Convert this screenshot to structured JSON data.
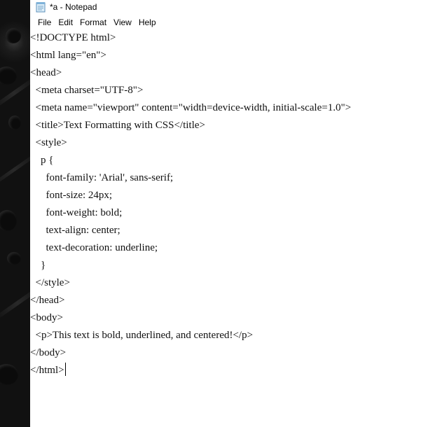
{
  "window": {
    "title": "*a - Notepad"
  },
  "menu": {
    "items": [
      "File",
      "Edit",
      "Format",
      "View",
      "Help"
    ]
  },
  "editor": {
    "lines": [
      "<!DOCTYPE html>",
      "<html lang=\"en\">",
      "<head>",
      "  <meta charset=\"UTF-8\">",
      "  <meta name=\"viewport\" content=\"width=device-width, initial-scale=1.0\">",
      "  <title>Text Formatting with CSS</title>",
      "  <style>",
      "    p {",
      "      font-family: 'Arial', sans-serif;",
      "      font-size: 24px;",
      "      font-weight: bold;",
      "      text-align: center;",
      "      text-decoration: underline;",
      "    }",
      "  </style>",
      "</head>",
      "<body>",
      "  <p>This text is bold, underlined, and centered!</p>",
      "</body>",
      "</html>"
    ]
  },
  "icons": {
    "app_icon": "notepad-icon",
    "text_cursor": "text-caret"
  }
}
